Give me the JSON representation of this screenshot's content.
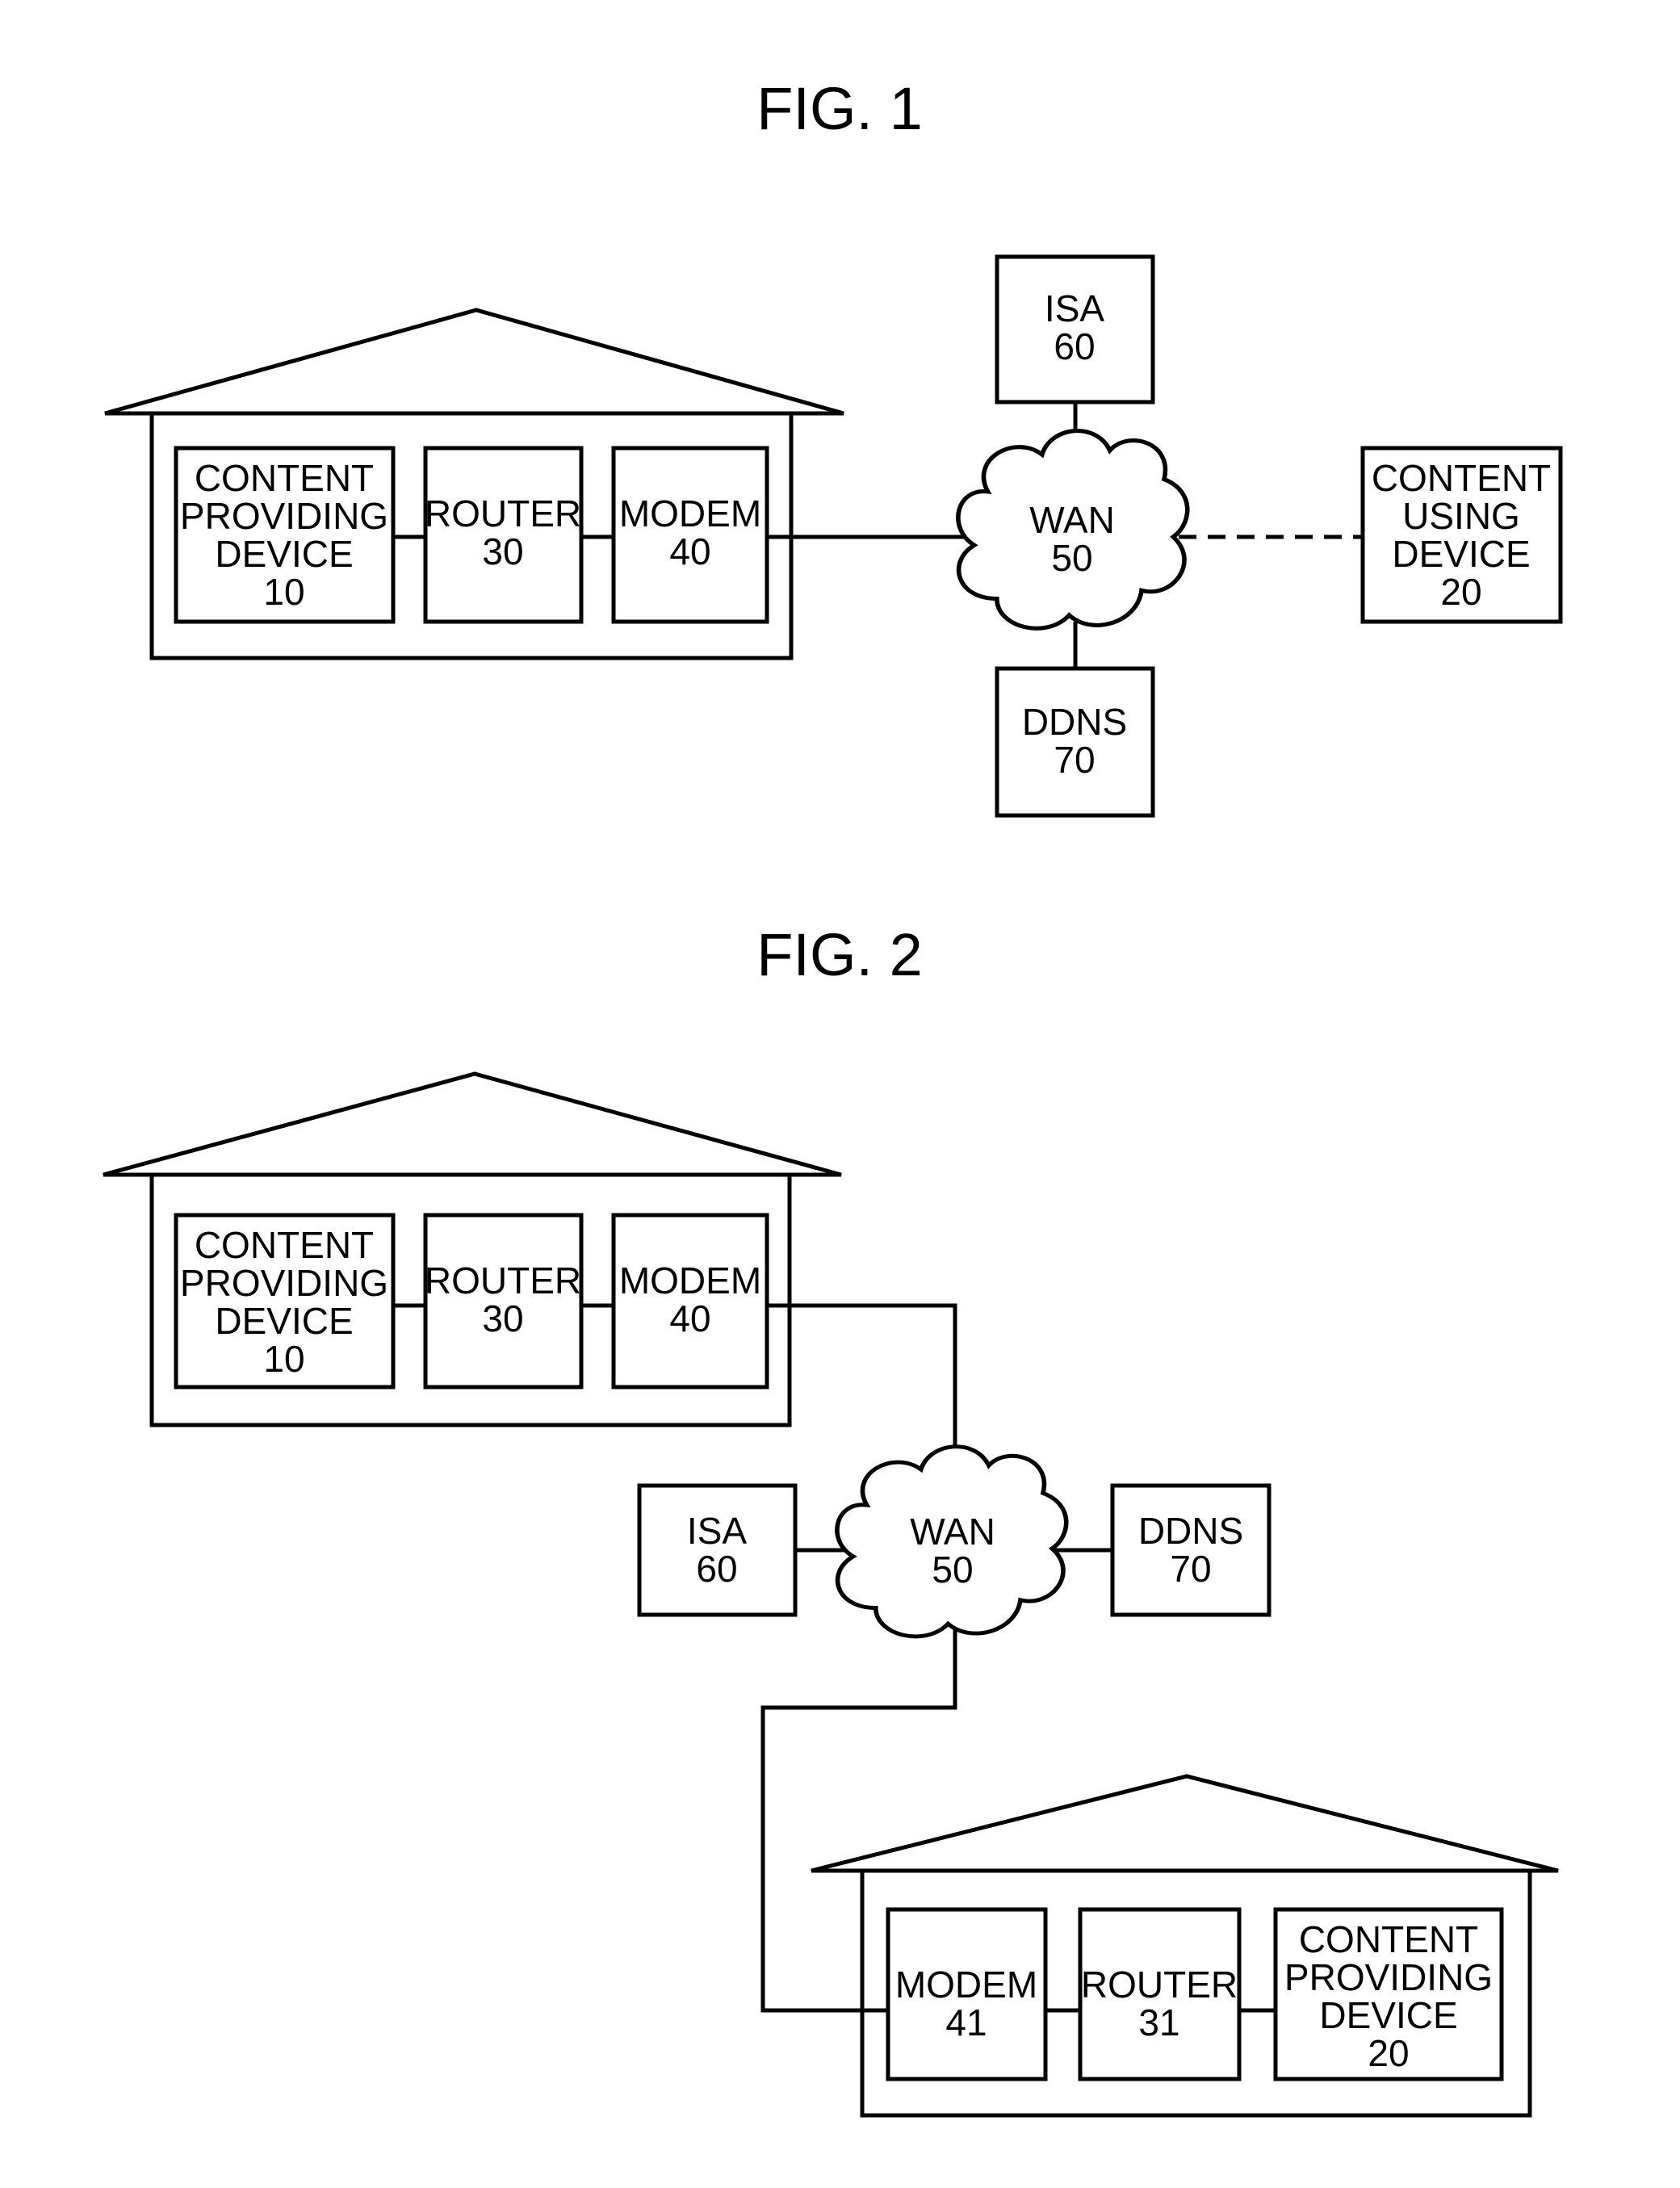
{
  "fig1": {
    "title": "FIG. 1",
    "house": {
      "content_providing_device": {
        "lines": [
          "CONTENT",
          "PROVIDING",
          "DEVICE",
          "10"
        ]
      },
      "router": {
        "lines": [
          "ROUTER",
          "30"
        ]
      },
      "modem": {
        "lines": [
          "MODEM",
          "40"
        ]
      }
    },
    "wan": {
      "lines": [
        "WAN",
        "50"
      ]
    },
    "isa": {
      "lines": [
        "ISA",
        "60"
      ]
    },
    "ddns": {
      "lines": [
        "DDNS",
        "70"
      ]
    },
    "content_using_device": {
      "lines": [
        "CONTENT",
        "USING",
        "DEVICE",
        "20"
      ]
    },
    "connections": [
      {
        "from": "CONTENT PROVIDING DEVICE 10",
        "to": "ROUTER 30",
        "style": "solid"
      },
      {
        "from": "ROUTER 30",
        "to": "MODEM 40",
        "style": "solid"
      },
      {
        "from": "MODEM 40",
        "to": "WAN 50",
        "style": "solid"
      },
      {
        "from": "ISA 60",
        "to": "WAN 50",
        "style": "solid"
      },
      {
        "from": "DDNS 70",
        "to": "WAN 50",
        "style": "solid"
      },
      {
        "from": "WAN 50",
        "to": "CONTENT USING DEVICE 20",
        "style": "dashed"
      }
    ]
  },
  "fig2": {
    "title": "FIG. 2",
    "house_a": {
      "content_providing_device": {
        "lines": [
          "CONTENT",
          "PROVIDING",
          "DEVICE",
          "10"
        ]
      },
      "router": {
        "lines": [
          "ROUTER",
          "30"
        ]
      },
      "modem": {
        "lines": [
          "MODEM",
          "40"
        ]
      }
    },
    "wan": {
      "lines": [
        "WAN",
        "50"
      ]
    },
    "isa": {
      "lines": [
        "ISA",
        "60"
      ]
    },
    "ddns": {
      "lines": [
        "DDNS",
        "70"
      ]
    },
    "house_b": {
      "modem": {
        "lines": [
          "MODEM",
          "41"
        ]
      },
      "router": {
        "lines": [
          "ROUTER",
          "31"
        ]
      },
      "content_providing_device": {
        "lines": [
          "CONTENT",
          "PROVIDING",
          "DEVICE",
          "20"
        ]
      }
    },
    "connections": [
      {
        "from": "CONTENT PROVIDING DEVICE 10",
        "to": "ROUTER 30",
        "style": "solid"
      },
      {
        "from": "ROUTER 30",
        "to": "MODEM 40",
        "style": "solid"
      },
      {
        "from": "MODEM 40",
        "to": "WAN 50",
        "style": "solid"
      },
      {
        "from": "ISA 60",
        "to": "WAN 50",
        "style": "solid"
      },
      {
        "from": "WAN 50",
        "to": "DDNS 70",
        "style": "solid"
      },
      {
        "from": "WAN 50",
        "to": "MODEM 41",
        "style": "solid"
      },
      {
        "from": "MODEM 41",
        "to": "ROUTER 31",
        "style": "solid"
      },
      {
        "from": "ROUTER 31",
        "to": "CONTENT PROVIDING DEVICE 20",
        "style": "solid"
      }
    ]
  }
}
